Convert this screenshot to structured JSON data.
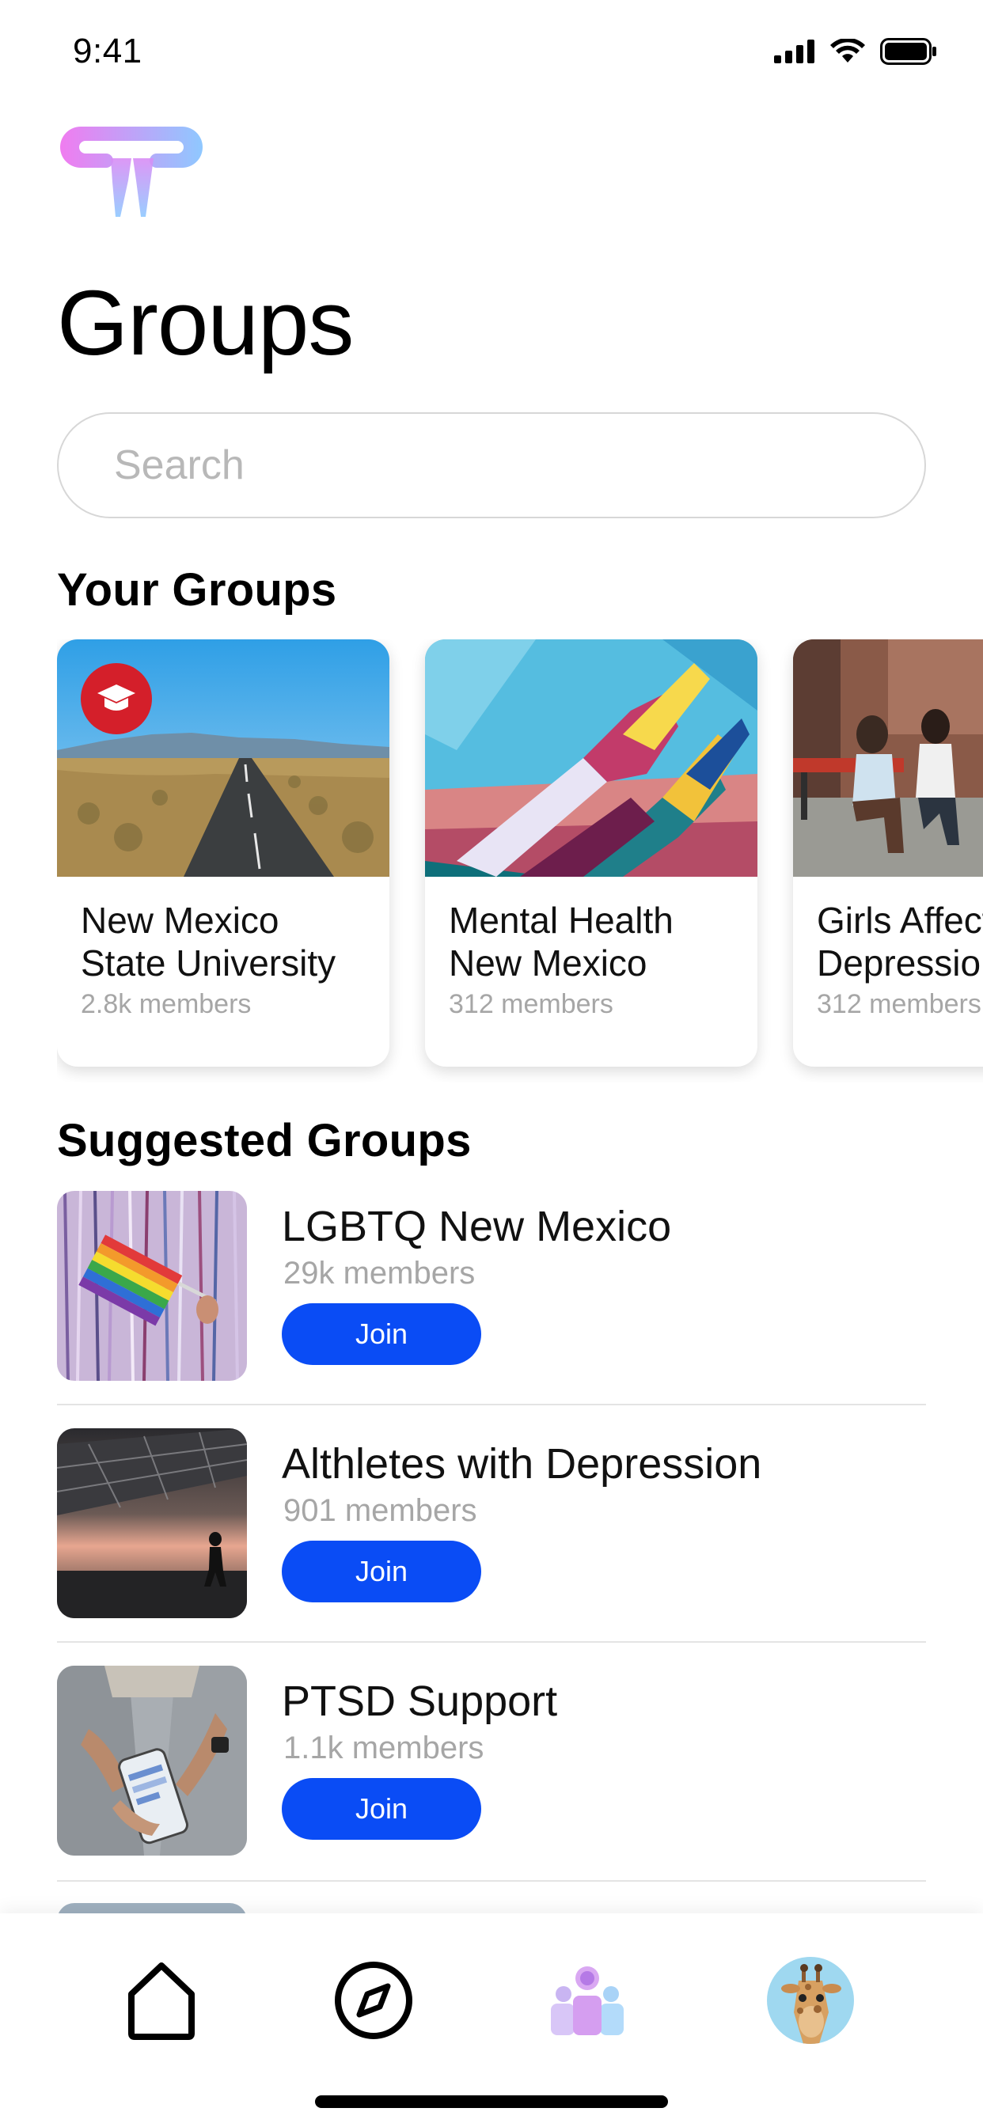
{
  "status_bar": {
    "time": "9:41",
    "icons": [
      "cellular-signal-icon",
      "wifi-icon",
      "battery-icon"
    ]
  },
  "header": {
    "logo_icon": "app-logo-icon",
    "title": "Groups"
  },
  "search": {
    "placeholder": "Search",
    "value": ""
  },
  "your_groups": {
    "title": "Your Groups",
    "cards": [
      {
        "title": "New Mexico\nState University",
        "members": "2.8k members",
        "badge_icon": "graduation-cap-icon",
        "image": "desert-road-photo"
      },
      {
        "title": "Mental Health\nNew Mexico",
        "members": "312 members",
        "image": "painted-hands-mural-photo"
      },
      {
        "title": "Girls Affected\nDepression",
        "members": "312 members",
        "image": "women-on-bench-photo"
      }
    ]
  },
  "suggested_groups": {
    "title": "Suggested Groups",
    "join_label": "Join",
    "items": [
      {
        "name": "LGBTQ New Mexico",
        "members": "29k members",
        "image": "rainbow-flag-photo"
      },
      {
        "name": "Althletes with Depression",
        "members": "901 members",
        "image": "runner-under-canopy-photo"
      },
      {
        "name": "PTSD Support",
        "members": "1.1k members",
        "image": "hands-holding-phone-photo"
      }
    ]
  },
  "tab_bar": {
    "tabs": [
      {
        "name": "home",
        "icon": "home-icon"
      },
      {
        "name": "explore",
        "icon": "compass-icon"
      },
      {
        "name": "groups",
        "icon": "groups-icon",
        "active": true
      },
      {
        "name": "profile",
        "icon": "giraffe-avatar"
      }
    ]
  },
  "colors": {
    "accent": "#0a4cf5",
    "badge": "#d41f2a",
    "muted_text": "#a6a6a6",
    "logo_gradient": [
      "#f07cf0",
      "#8fc8ff"
    ]
  }
}
